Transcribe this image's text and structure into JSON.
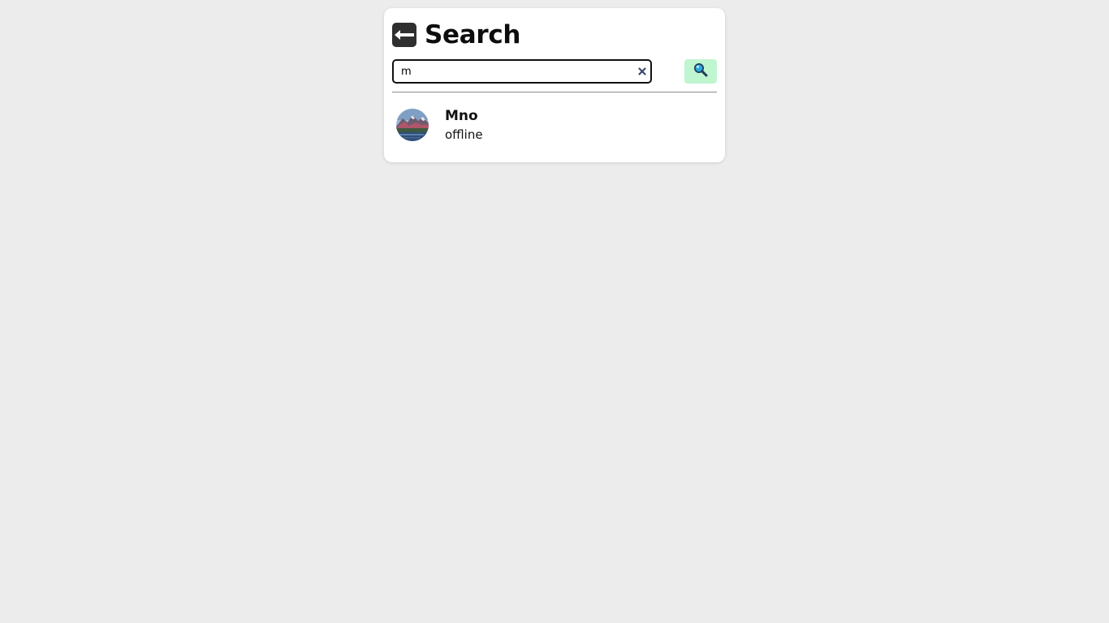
{
  "header": {
    "title": "Search",
    "back_icon": "back-arrow-icon"
  },
  "search": {
    "value": "m",
    "placeholder": "",
    "clear_icon": "close-icon",
    "button_icon": "magnifier-icon"
  },
  "results": [
    {
      "name": "Mno",
      "status": "offline",
      "avatar": "landscape-avatar"
    }
  ],
  "colors": {
    "background": "#ececec",
    "panel": "#ffffff",
    "search_button": "#bff5cf",
    "back_button": "#2f2f2f",
    "clear_icon": "#3b4a6b"
  }
}
